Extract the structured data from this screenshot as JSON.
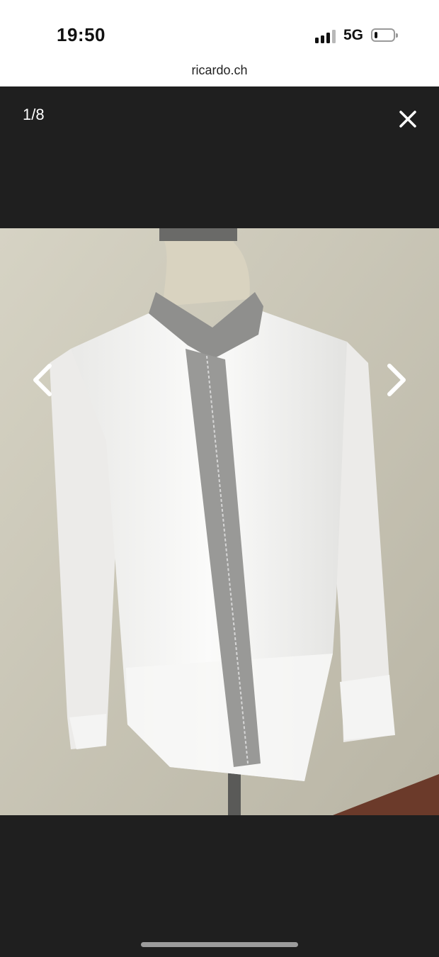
{
  "status_bar": {
    "time": "19:50",
    "network": "5G",
    "battery_level": 0.15,
    "signal_bars_active": 3,
    "signal_bars_total": 4
  },
  "browser": {
    "url": "ricardo.ch"
  },
  "viewer": {
    "counter": "1/8",
    "close_icon": "close-icon",
    "prev_icon": "chevron-left-icon",
    "next_icon": "chevron-right-icon"
  },
  "photo": {
    "subject": "white shirt with grey collar and placket on dress form",
    "colors": {
      "wall": "#c9c5b6",
      "shirt": "#f3f3f1",
      "trim": "#8f8f8d",
      "stand": "#5a5a58"
    }
  }
}
